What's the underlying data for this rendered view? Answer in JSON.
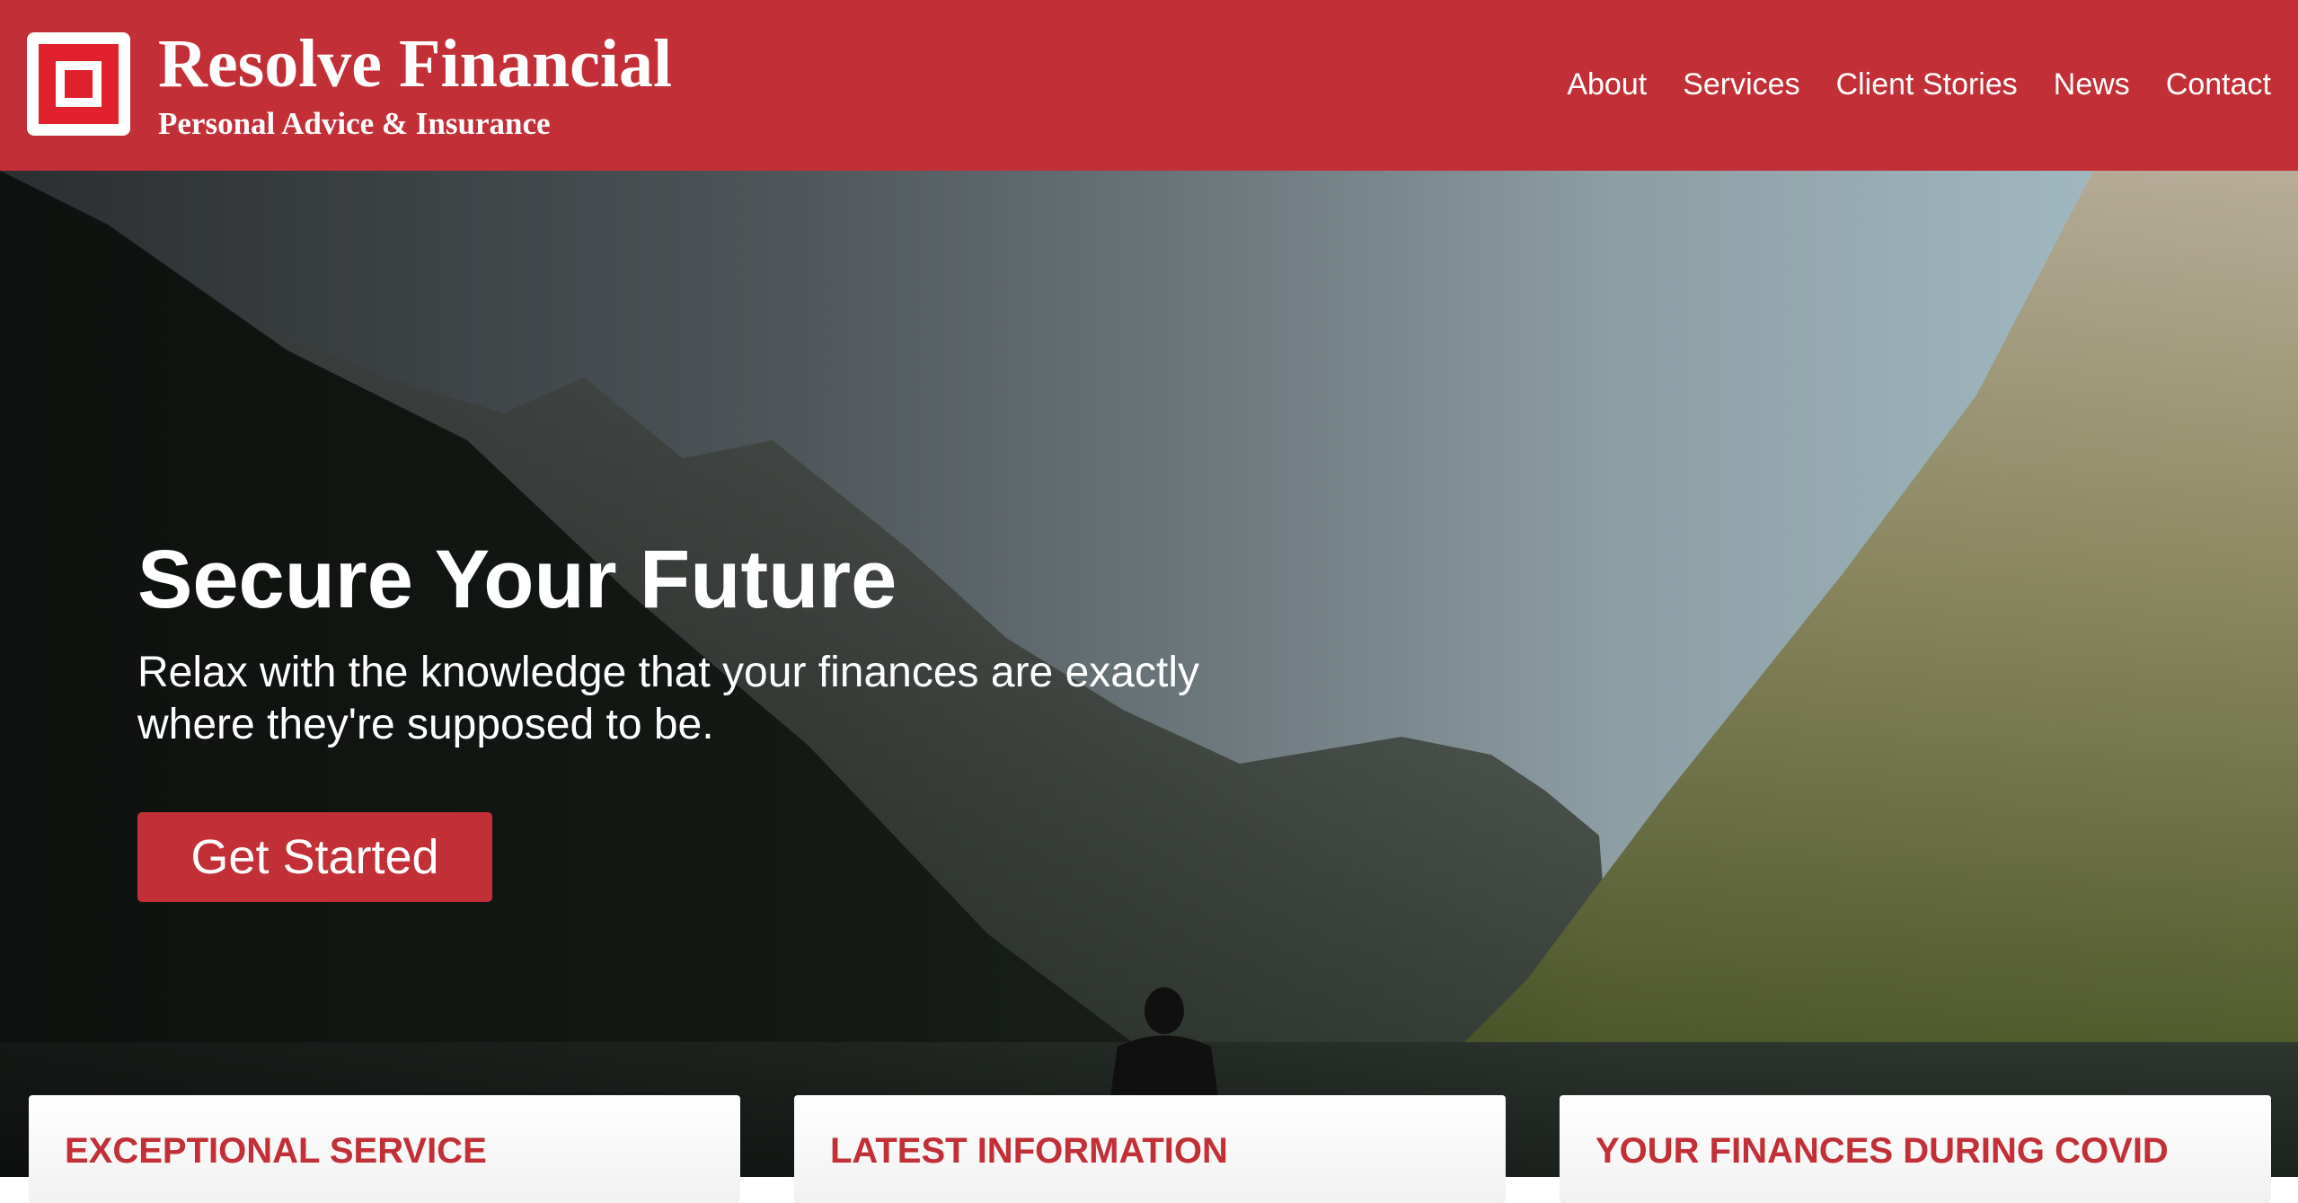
{
  "brand": {
    "name": "Resolve Financial",
    "tagline": "Personal Advice & Insurance"
  },
  "nav": {
    "items": [
      {
        "label": "About"
      },
      {
        "label": "Services"
      },
      {
        "label": "Client Stories"
      },
      {
        "label": "News"
      },
      {
        "label": "Contact"
      }
    ]
  },
  "hero": {
    "title": "Secure Your Future",
    "subtitle": "Relax with the knowledge that your finances are exactly where they're supposed to be.",
    "cta_label": "Get Started"
  },
  "cards": [
    {
      "title": "EXCEPTIONAL SERVICE"
    },
    {
      "title": "LATEST INFORMATION"
    },
    {
      "title": "YOUR FINANCES DURING COVID"
    }
  ],
  "colors": {
    "brand_red": "#c22f37",
    "logo_red": "#e0202c",
    "white": "#ffffff"
  },
  "icons": {
    "logo": "square-in-square-logo"
  }
}
